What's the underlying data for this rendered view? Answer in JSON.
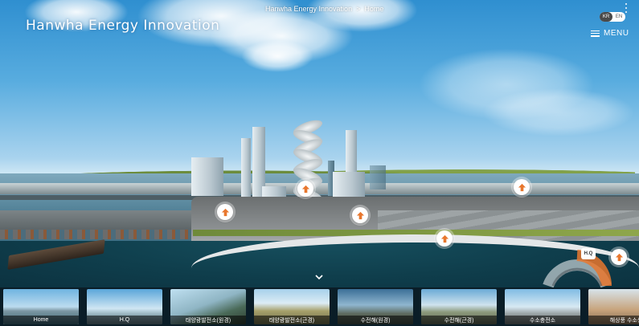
{
  "brand": {
    "title": "Hanwha Energy Innovation"
  },
  "breadcrumb": {
    "root": "Hanwha Energy Innovation",
    "separator": ">",
    "current": "Home"
  },
  "language": {
    "active": "KR",
    "other": "EN"
  },
  "menu": {
    "label": "MENU"
  },
  "gauge": {
    "label": "H.Q"
  },
  "thumbnails": [
    {
      "label": "Home",
      "active": true
    },
    {
      "label": "H.Q",
      "active": false
    },
    {
      "label": "태양광발전소(원경)",
      "active": false
    },
    {
      "label": "태양광발전소(근경)",
      "active": false
    },
    {
      "label": "수전해(원경)",
      "active": false
    },
    {
      "label": "수전해(근경)",
      "active": false
    },
    {
      "label": "수소충전소",
      "active": false
    },
    {
      "label": "해상풍 수소생",
      "active": false
    }
  ],
  "colors": {
    "strip_bg": "#0a1c26",
    "hotspot": "#e8772e",
    "accent": "#ffffff"
  },
  "icons": {
    "hotspot": "arrow-up-icon",
    "menu": "hamburger-icon",
    "more": "kebab-icon",
    "collapse": "chevron-down-icon"
  }
}
